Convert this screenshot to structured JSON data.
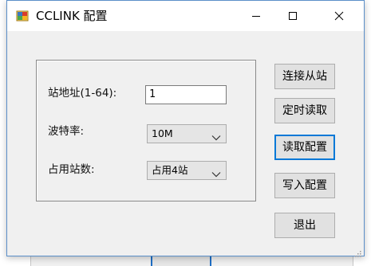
{
  "window": {
    "title": "CCLINK 配置",
    "title_icon": "app-icon",
    "controls": [
      "minimize-icon",
      "maximize-icon",
      "close-icon"
    ]
  },
  "form": {
    "station_address": {
      "label": "站地址(1-64):",
      "value": "1"
    },
    "baud_rate": {
      "label": "波特率:",
      "selected": "10M"
    },
    "occupied_stations": {
      "label": "占用站数:",
      "selected": "占用4站"
    }
  },
  "buttons": {
    "connect_slave": "连接从站",
    "timed_read": "定时读取",
    "read_config": "读取配置",
    "write_config": "写入配置",
    "exit": "退出"
  },
  "colors": {
    "window_bg": "#f0f0f0",
    "titlebar_bg": "#ffffff",
    "focus_border": "#0078d7",
    "button_bg": "#e1e1e1"
  }
}
